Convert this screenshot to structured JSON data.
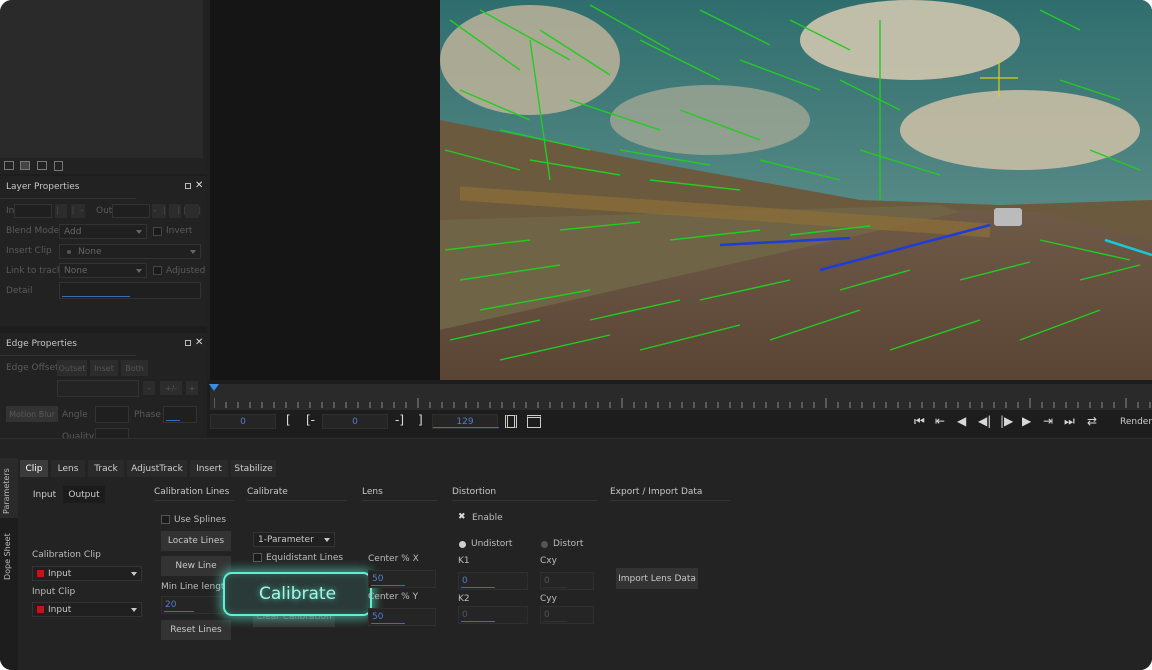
{
  "layer_properties": {
    "title": "Layer Properties",
    "in_label": "In",
    "out_label": "Out",
    "blend_mode_label": "Blend Mode",
    "blend_mode_value": "Add",
    "invert_label": "Invert",
    "insert_clip_label": "Insert Clip",
    "insert_clip_value": "None",
    "link_to_track_label": "Link to track",
    "link_to_track_value": "None",
    "adjusted_label": "Adjusted",
    "detail_label": "Detail"
  },
  "edge_properties": {
    "title": "Edge Properties",
    "edge_offset_label": "Edge Offset",
    "btn_1": "Outset",
    "btn_2": "Inset",
    "btn_3": "Both",
    "motion_blur_label": "Motion Blur",
    "angle_label": "Angle",
    "phase_label": "Phase",
    "quality_label": "Quality"
  },
  "timeline": {
    "current_frame": "0",
    "in_bracket": "[",
    "in_marker": "[-",
    "in_value": "0",
    "out_marker": "-]",
    "out_bracket": "]",
    "end_frame": "129",
    "render_label": "Render"
  },
  "side_tabs": {
    "parameters": "Parameters",
    "dope_sheet": "Dope Sheet"
  },
  "tabs": [
    "Clip",
    "Lens",
    "Track",
    "AdjustTrack",
    "Insert",
    "Stabilize"
  ],
  "clip_subtabs": [
    "Input",
    "Output"
  ],
  "clip_section": {
    "calibration_clip_label": "Calibration Clip",
    "calibration_clip_value": "Input",
    "input_clip_label": "Input Clip",
    "input_clip_value": "Input"
  },
  "calibration_lines": {
    "title": "Calibration Lines",
    "use_splines_label": "Use Splines",
    "locate_lines": "Locate Lines",
    "new_line": "New Line",
    "min_line_length_label": "Min Line length",
    "min_line_length_value": "20",
    "reset_lines": "Reset Lines"
  },
  "calibrate_section": {
    "title": "Calibrate",
    "parameter_mode": "1-Parameter",
    "equidistant_lines_label": "Equidistant Lines",
    "calibrate_button": "Calibrate",
    "clear_calibration": "Clear Calibration"
  },
  "lens_section": {
    "title": "Lens",
    "center_x_label": "Center % X",
    "center_x_value": "50",
    "center_y_label": "Center % Y",
    "center_y_value": "50"
  },
  "distortion_section": {
    "title": "Distortion",
    "enable_label": "Enable",
    "undistort_label": "Undistort",
    "distort_label": "Distort",
    "k1_label": "K1",
    "k1_value": "0",
    "cxy_label": "Cxy",
    "cxy_value": "0",
    "k2_label": "K2",
    "k2_value": "0",
    "cyy_label": "Cyy",
    "cyy_value": "0"
  },
  "export_section": {
    "title": "Export / Import Data",
    "import_lens_data": "Import Lens Data"
  },
  "colors": {
    "accent_blue": "#3a6fb8",
    "calibrate_glow": "#5ef0d2",
    "line_green": "#22cc22",
    "line_blue": "#1e3cd8",
    "line_cyan": "#18c8d8",
    "crosshair": "#d8d020"
  }
}
